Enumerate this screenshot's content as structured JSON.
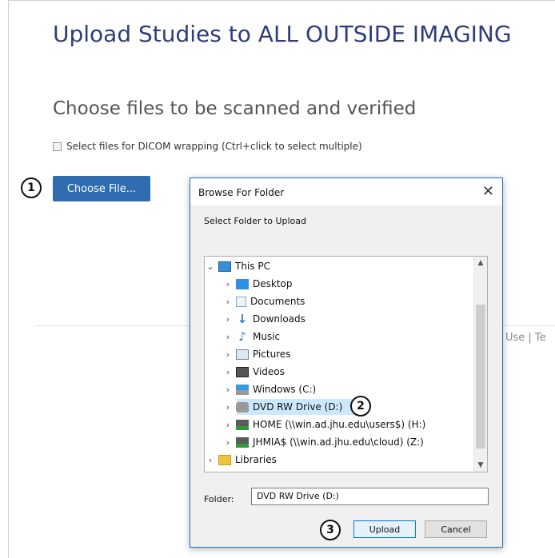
{
  "page": {
    "title": "Upload Studies to ALL OUTSIDE IMAGING",
    "section_title": "Choose files to be scanned and verified",
    "dicom_checkbox_label": "Select files for DICOM wrapping (Ctrl+click to select multiple)",
    "choose_file_label": "Choose File...",
    "footer_links": "Use  |  Te"
  },
  "callouts": {
    "one": "1",
    "two": "2",
    "three": "3"
  },
  "dialog": {
    "title": "Browse For Folder",
    "close_label": "✕",
    "prompt": "Select Folder to Upload",
    "tree": [
      {
        "label": "This PC",
        "chevron": "⌄",
        "icon": "computer-icon"
      },
      {
        "label": "Desktop",
        "chevron": "›",
        "icon": "desktop-icon"
      },
      {
        "label": "Documents",
        "chevron": "›",
        "icon": "documents-icon"
      },
      {
        "label": "Downloads",
        "chevron": "›",
        "icon": "downloads-icon"
      },
      {
        "label": "Music",
        "chevron": "›",
        "icon": "music-icon"
      },
      {
        "label": "Pictures",
        "chevron": "›",
        "icon": "pictures-icon"
      },
      {
        "label": "Videos",
        "chevron": "›",
        "icon": "videos-icon"
      },
      {
        "label": "Windows (C:)",
        "chevron": "›",
        "icon": "windows-drive-icon"
      },
      {
        "label": "DVD RW Drive (D:)",
        "chevron": "›",
        "icon": "dvd-drive-icon"
      },
      {
        "label": "HOME (\\\\win.ad.jhu.edu\\users$) (H:)",
        "chevron": "›",
        "icon": "network-drive-icon"
      },
      {
        "label": "JHMIA$ (\\\\win.ad.jhu.edu\\cloud) (Z:)",
        "chevron": "›",
        "icon": "network-drive-icon"
      },
      {
        "label": "Libraries",
        "chevron": "›",
        "icon": "libraries-icon"
      }
    ],
    "selected_index": 8,
    "folder_label": "Folder:",
    "folder_value": "DVD RW Drive (D:)",
    "upload_label": "Upload",
    "cancel_label": "Cancel",
    "scroll_up": "▲",
    "scroll_down": "▼"
  }
}
